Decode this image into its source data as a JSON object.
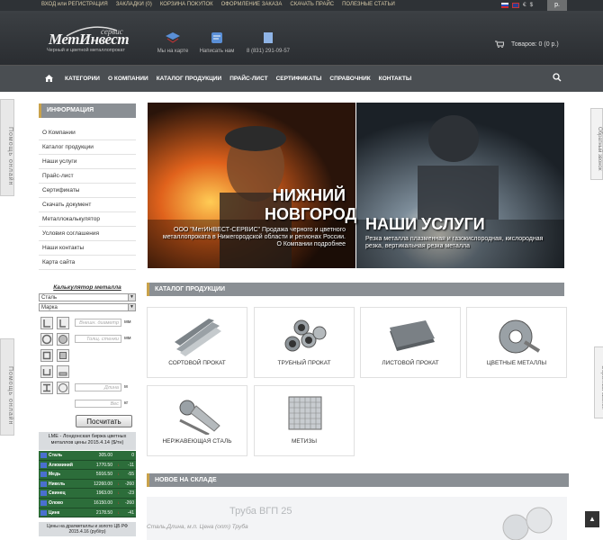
{
  "topbar": {
    "links": [
      "ВХОД или РЕГИСТРАЦИЯ",
      "ЗАКЛАДКИ (0)",
      "КОРЗИНА ПОКУПОК",
      "ОФОРМЛЕНИЕ ЗАКАЗА",
      "СКАЧАТЬ ПРАЙС",
      "ПОЛЕЗНЫЕ СТАТЬИ"
    ],
    "currencies": [
      "€",
      "$"
    ],
    "lang": "р."
  },
  "header": {
    "logo_name": "МетИнвест",
    "logo_service": "сервис",
    "logo_tagline": "Черный и цветной металлопрокат",
    "map_label": "Мы на карте",
    "write_label": "Написать нам",
    "phone": "8 (831) 291-09-57",
    "cart_label": "Товаров: 0 (0 р.)"
  },
  "nav": {
    "items": [
      "КАТЕГОРИИ",
      "О КОМПАНИИ",
      "КАТАЛОГ ПРОДУКЦИИ",
      "ПРАЙС-ЛИСТ",
      "СЕРТИФИКАТЫ",
      "СПРАВОЧНИК",
      "КОНТАКТЫ"
    ]
  },
  "sidetabs": {
    "help": "Помощь онлайн",
    "callback": "Обратный звонок"
  },
  "info": {
    "title": "ИНФОРМАЦИЯ",
    "items": [
      "О Компании",
      "Каталог продукции",
      "Наши услуги",
      "Прайс-лист",
      "Сертификаты",
      "Скачать документ",
      "Металлокалькулятор",
      "Условия соглашения",
      "Наши контакты",
      "Карта сайта"
    ]
  },
  "calculator": {
    "title": "Калькулятор металла",
    "material": "Сталь",
    "grade": "Марка",
    "diameter_placeholder": "Внешн. диаметр",
    "thickness_placeholder": "Толщ. стенки",
    "length_placeholder": "Длина",
    "weight_placeholder": "Вес",
    "unit_mm": "мм",
    "unit_m": "м",
    "unit_kg": "кг",
    "button": "Посчитать"
  },
  "lme": {
    "title": "LME - Лондонская биржа цветных металлов цены 2015.4.14 ($/тн)",
    "rows": [
      {
        "name": "Сталь",
        "value": "305.00",
        "delta": "0"
      },
      {
        "name": "Алюминий",
        "value": "1770.50",
        "delta": "-11"
      },
      {
        "name": "Медь",
        "value": "5916.50",
        "delta": "-55"
      },
      {
        "name": "Никель",
        "value": "12260.00",
        "delta": "-260"
      },
      {
        "name": "Свинец",
        "value": "1963.00",
        "delta": "-23"
      },
      {
        "name": "Олово",
        "value": "16150.00",
        "delta": "-260"
      },
      {
        "name": "Цинк",
        "value": "2178.50",
        "delta": "-41"
      }
    ],
    "gold_title": "Цены на драгметаллы и золото ЦБ РФ 2015.4.16 (руб/гр)"
  },
  "slider": {
    "city": "НИЖНИЙ НОВГОРОД",
    "services": "НАШИ УСЛУГИ",
    "caption1": "ООО \"МетИНВЕСТ-СЕРВИС\" Продажа черного и цветного металлопроката в Нижегородской области и регионах России. О Компании подробнее",
    "caption2": "Резка металла плазменная и газокислородная, кислородная резка, вертикальная резка металла"
  },
  "catalog": {
    "title": "КАТАЛОГ ПРОДУКЦИИ",
    "items": [
      "СОРТОВОЙ ПРОКАТ",
      "ТРУБНЫЙ ПРОКАТ",
      "ЛИСТОВОЙ ПРОКАТ",
      "ЦВЕТНЫЕ МЕТАЛЛЫ",
      "НЕРЖАВЕЮЩАЯ СТАЛЬ",
      "МЕТИЗЫ"
    ]
  },
  "stock": {
    "title": "НОВОЕ НА СКЛАДЕ",
    "item": "Труба ВГП 25",
    "spec": "Сталь,Длина, м.п. Цена (опт) Труба"
  }
}
